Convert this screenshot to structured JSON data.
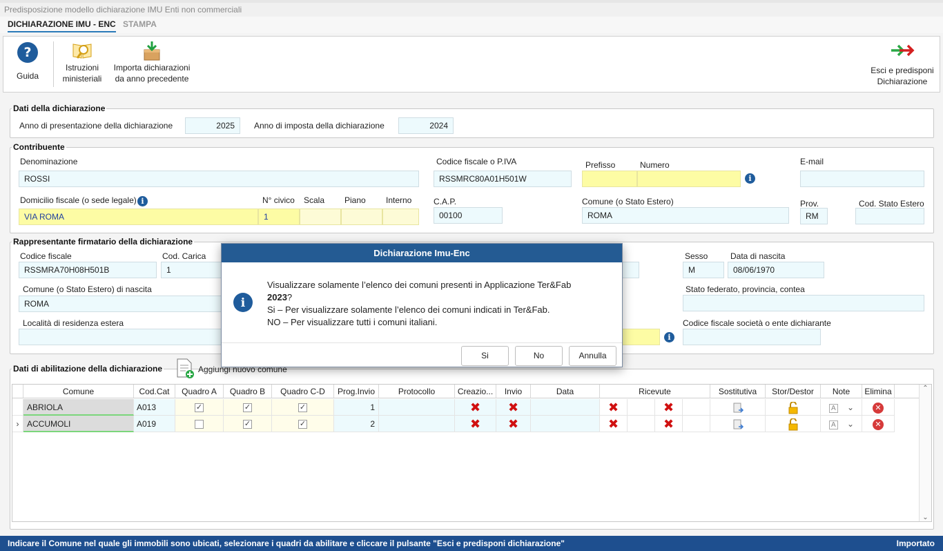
{
  "window": {
    "title": "Predisposizione modello dichiarazione IMU Enti non commerciali"
  },
  "tabs": [
    {
      "label": "DICHIARAZIONE IMU - ENC",
      "active": true
    },
    {
      "label": "STAMPA",
      "active": false
    }
  ],
  "ribbon": {
    "guida": "Guida",
    "istruzioni_1": "Istruzioni",
    "istruzioni_2": "ministeriali",
    "importa_1": "Importa dichiarazioni",
    "importa_2": "da anno precedente",
    "esci_1": "Esci e predisponi",
    "esci_2": "Dichiarazione"
  },
  "dati_dichiarazione": {
    "legend": "Dati della dichiarazione",
    "anno_presentazione_label": "Anno di presentazione della dichiarazione",
    "anno_presentazione": "2025",
    "anno_imposta_label": "Anno di imposta della dichiarazione",
    "anno_imposta": "2024"
  },
  "contribuente": {
    "legend": "Contribuente",
    "denominazione_label": "Denominazione",
    "denominazione": "ROSSI",
    "cf_label": "Codice fiscale o P.IVA",
    "cf": "RSSMRC80A01H501W",
    "prefisso_label": "Prefisso",
    "numero_label": "Numero",
    "email_label": "E-mail",
    "domicilio_label": "Domicilio fiscale (o sede legale)",
    "domicilio": "VIA ROMA",
    "civico_label": "N° civico",
    "civico": "1",
    "scala_label": "Scala",
    "piano_label": "Piano",
    "interno_label": "Interno",
    "cap_label": "C.A.P.",
    "cap": "00100",
    "comune_label": "Comune (o Stato Estero)",
    "comune": "ROMA",
    "prov_label": "Prov.",
    "prov": "RM",
    "stato_estero_label": "Cod. Stato Estero"
  },
  "rappresentante": {
    "legend": "Rappresentante firmatario della dichiarazione",
    "cf_label": "Codice fiscale",
    "cf": "RSSMRA70H08H501B",
    "carica_label": "Cod. Carica",
    "carica": "1",
    "sesso_label": "Sesso",
    "sesso": "M",
    "nascita_label": "Data di nascita",
    "nascita": "08/06/1970",
    "comune_nascita_label": "Comune (o Stato Estero) di nascita",
    "comune_nascita": "ROMA",
    "stato_federato_label": "Stato federato, provincia, contea",
    "localita_label": "Località di residenza estera",
    "cf_societa_label": "Codice fiscale società o ente dichiarante"
  },
  "abilitazione": {
    "legend": "Dati di abilitazione della dichiarazione",
    "add_label": "Aggiungi nuovo comune",
    "columns": [
      "Comune",
      "Cod.Cat",
      "Quadro A",
      "Quadro B",
      "Quadro C-D",
      "Prog.Invio",
      "Protocollo",
      "Creazio...",
      "Invio",
      "Data",
      "Ricevute",
      "Sostitutiva",
      "Stor/Destor",
      "Note",
      "Elimina"
    ],
    "rows": [
      {
        "comune": "ABRIOLA",
        "codcat": "A013",
        "qa": true,
        "qb": true,
        "qcd": true,
        "prog": "1"
      },
      {
        "comune": "ACCUMOLI",
        "codcat": "A019",
        "qa": false,
        "qb": true,
        "qcd": true,
        "prog": "2"
      }
    ]
  },
  "dialog": {
    "title": "Dichiarazione Imu-Enc",
    "line1": "Visualizzare solamente l’elenco dei comuni presenti in Applicazione Ter&Fab",
    "year": "2023",
    "year_suffix": "?",
    "line3": "Si – Per visualizzare solamente l’elenco dei comuni indicati in Ter&Fab.",
    "line4": "NO – Per visualizzare tutti i comuni italiani.",
    "btn_si": "Si",
    "btn_no": "No",
    "btn_annulla": "Annulla"
  },
  "status": {
    "message": "Indicare il Comune nel quale gli immobili sono ubicati, selezionare i quadri da abilitare e cliccare il pulsante \"Esci e predisponi dichiarazione\"",
    "right": "Importato"
  },
  "colors": {
    "accent": "#245b93",
    "cyan_field": "#edfafd",
    "yellow_field": "#fdfca4",
    "status_bar": "#1e4f8f"
  }
}
